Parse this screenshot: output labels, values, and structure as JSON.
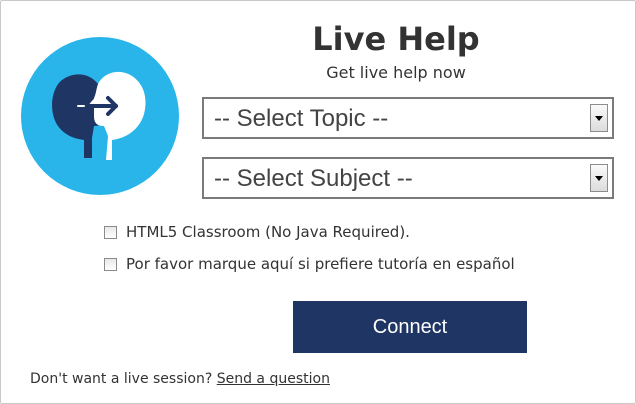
{
  "header": {
    "title": "Live Help",
    "subtitle": "Get live help now"
  },
  "logo": {
    "icon": "two-heads-exchange-icon",
    "circle_color": "#29b5ea",
    "dark_head_color": "#1f3563",
    "light_head_color": "#ffffff"
  },
  "form": {
    "topic_select": {
      "selected": "-- Select Topic --"
    },
    "subject_select": {
      "selected": "-- Select Subject --"
    },
    "html5_checkbox": {
      "label": "HTML5 Classroom (No Java Required).",
      "checked": false
    },
    "spanish_checkbox": {
      "label": "Por favor marque aquí si prefiere tutoría en español",
      "checked": false
    },
    "connect_label": "Connect"
  },
  "footer": {
    "prompt": "Don't want a live session?",
    "link_label": "Send a question"
  },
  "colors": {
    "button_bg": "#1f3563",
    "text": "#333333"
  }
}
